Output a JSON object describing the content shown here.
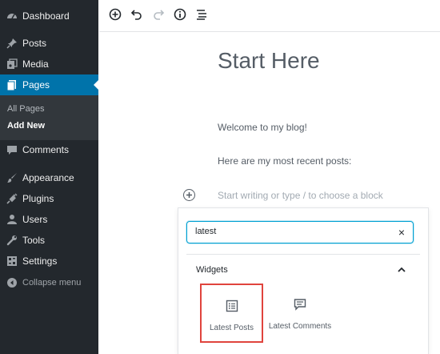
{
  "sidebar": {
    "items": [
      {
        "label": "Dashboard",
        "icon": "dashboard-icon"
      },
      {
        "label": "Posts",
        "icon": "pin-icon"
      },
      {
        "label": "Media",
        "icon": "media-icon"
      },
      {
        "label": "Pages",
        "icon": "pages-icon",
        "active": true
      },
      {
        "label": "Comments",
        "icon": "comment-icon"
      },
      {
        "label": "Appearance",
        "icon": "brush-icon"
      },
      {
        "label": "Plugins",
        "icon": "plug-icon"
      },
      {
        "label": "Users",
        "icon": "user-icon"
      },
      {
        "label": "Tools",
        "icon": "wrench-icon"
      },
      {
        "label": "Settings",
        "icon": "settings-icon"
      }
    ],
    "submenu": [
      "All Pages",
      "Add New"
    ],
    "collapse_label": "Collapse menu"
  },
  "toolbar": {
    "buttons": [
      "add-block-icon",
      "undo-icon",
      "redo-icon",
      "info-icon",
      "outline-icon"
    ]
  },
  "editor": {
    "title": "Start Here",
    "paragraphs": [
      "Welcome to my blog!",
      "Here are my most recent posts:"
    ],
    "placeholder": "Start writing or type / to choose a block"
  },
  "inserter": {
    "search_value": "latest",
    "clear_glyph": "×",
    "panel_title": "Widgets",
    "blocks": [
      {
        "label": "Latest Posts",
        "icon": "list-icon"
      },
      {
        "label": "Latest Comments",
        "icon": "comment-icon"
      }
    ]
  },
  "colors": {
    "sidebar_bg": "#23282d",
    "active_bg": "#0073aa",
    "highlight": "#e0443d",
    "focus": "#00a0d2"
  }
}
